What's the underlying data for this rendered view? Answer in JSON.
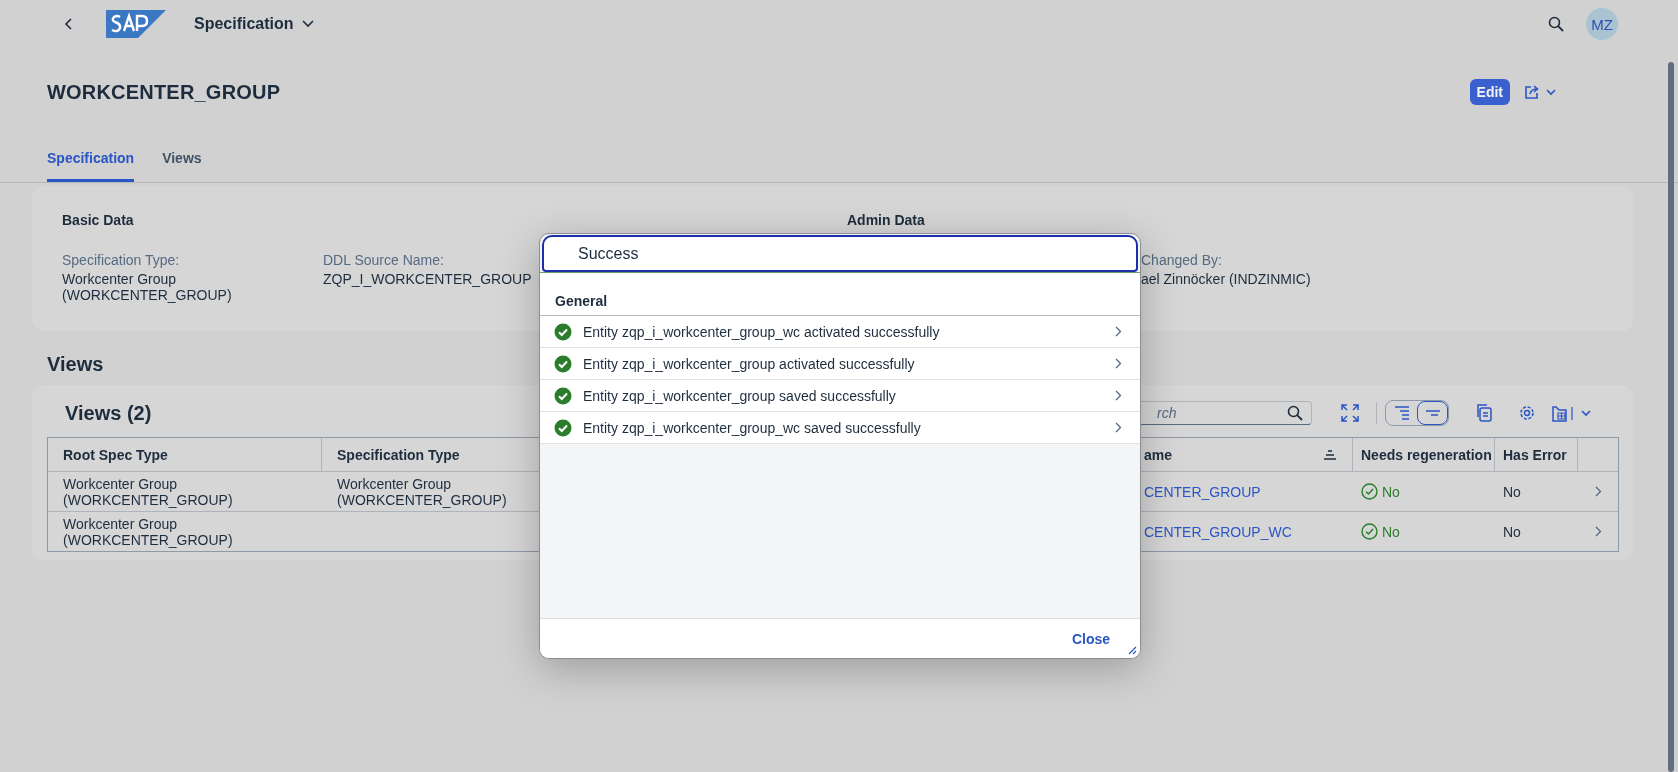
{
  "shell": {
    "title": "Specification",
    "avatar": "MZ"
  },
  "header": {
    "title": "WORKCENTER_GROUP",
    "edit": "Edit"
  },
  "tabs": [
    {
      "label": "Specification",
      "selected": true
    },
    {
      "label": "Views",
      "selected": false
    }
  ],
  "basic_data": {
    "title": "Basic Data",
    "fields": [
      {
        "label": "Specification Type:",
        "value": "Workcenter Group (WORKCENTER_GROUP)"
      },
      {
        "label": "DDL Source Name:",
        "value": "ZQP_I_WORKCENTER_GROUP"
      }
    ]
  },
  "admin_data": {
    "title": "Admin Data",
    "fields": [
      {
        "label": "Changed By:",
        "value": "ael Zinnöcker (INDZINMIC)"
      }
    ]
  },
  "views": {
    "heading": "Views",
    "table_title": "Views (2)",
    "search": {
      "placeholder": "rch"
    },
    "view_modes": [
      {
        "selected": false
      },
      {
        "selected": true
      }
    ],
    "columns": [
      "Root Spec Type",
      "Specification Type",
      "ame",
      "Needs regeneration",
      "Has Error"
    ],
    "rows": [
      {
        "root_spec_type": "Workcenter Group (WORKCENTER_GROUP)",
        "specification_type": "Workcenter Group (WORKCENTER_GROUP)",
        "name": "CENTER_GROUP",
        "needs_regeneration": "No",
        "has_error": "No"
      },
      {
        "root_spec_type": "Workcenter Group (WORKCENTER_GROUP)",
        "name": "CENTER_GROUP_WC",
        "needs_regeneration": "No",
        "has_error": "No"
      }
    ]
  },
  "dialog": {
    "title": "Success",
    "group": "General",
    "messages": [
      {
        "kind": "success",
        "text": "Entity zqp_i_workcenter_group_wc activated successfully"
      },
      {
        "kind": "success",
        "text": "Entity zqp_i_workcenter_group activated successfully"
      },
      {
        "kind": "success",
        "text": "Entity zqp_i_workcenter_group saved successfully"
      },
      {
        "kind": "success",
        "text": "Entity zqp_i_workcenter_group_wc saved successfully"
      }
    ],
    "close": "Close"
  }
}
